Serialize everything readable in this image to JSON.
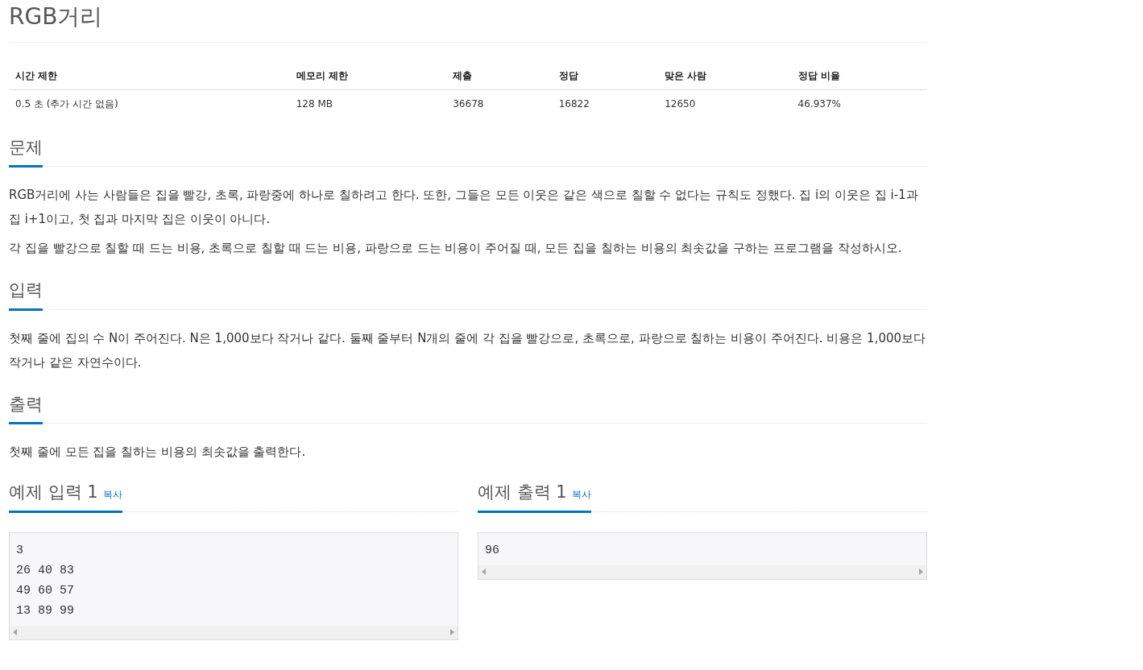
{
  "title": "RGB거리",
  "info_table": {
    "columns": [
      "시간 제한",
      "메모리 제한",
      "제출",
      "정답",
      "맞은 사람",
      "정답 비율"
    ],
    "rows": [
      [
        "0.5 초 (추가 시간 없음)",
        "128 MB",
        "36678",
        "16822",
        "12650",
        "46.937%"
      ]
    ]
  },
  "sections": [
    {
      "heading": "문제",
      "paragraphs": [
        "RGB거리에 사는 사람들은 집을 빨강, 초록, 파랑중에 하나로 칠하려고 한다. 또한, 그들은 모든 이웃은 같은 색으로 칠할 수 없다는 규칙도 정했다. 집 i의 이웃은 집 i-1과 집 i+1이고, 첫 집과 마지막 집은 이웃이 아니다.",
        "각 집을 빨강으로 칠할 때 드는 비용, 초록으로 칠할 때 드는 비용, 파랑으로 드는 비용이 주어질 때, 모든 집을 칠하는 비용의 최솟값을 구하는 프로그램을 작성하시오."
      ]
    },
    {
      "heading": "입력",
      "paragraphs": [
        "첫째 줄에 집의 수 N이 주어진다. N은 1,000보다 작거나 같다. 둘째 줄부터 N개의 줄에 각 집을 빨강으로, 초록으로, 파랑으로 칠하는 비용이 주어진다. 비용은 1,000보다 작거나 같은 자연수이다."
      ]
    },
    {
      "heading": "출력",
      "paragraphs": [
        "첫째 줄에 모든 집을 칠하는 비용의 최솟값을 출력한다."
      ]
    }
  ],
  "samples": [
    {
      "heading": "예제 입력 1",
      "copy_link": "복사",
      "lines": [
        "3",
        "26 40 83",
        "49 60 57",
        "13 89 99"
      ]
    },
    {
      "heading": "예제 출력 1",
      "copy_link": "복사",
      "lines": [
        "96"
      ]
    }
  ]
}
